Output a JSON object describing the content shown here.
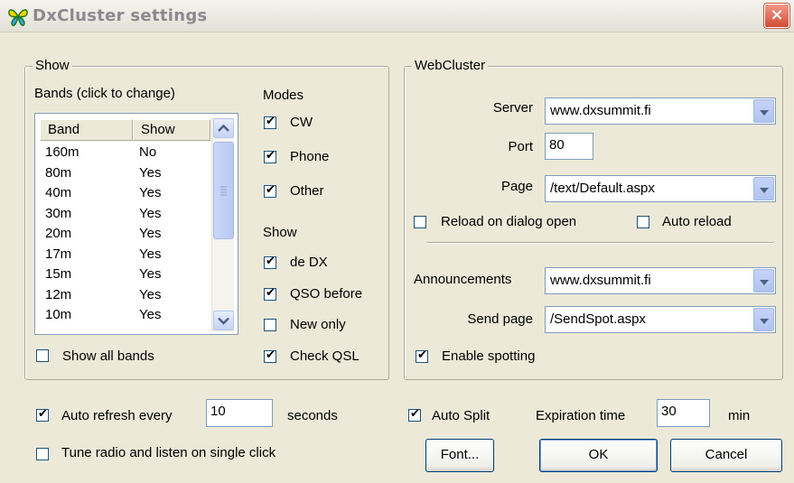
{
  "window": {
    "title": "DxCluster settings",
    "close": "×"
  },
  "show_group": {
    "legend": "Show",
    "bands_label": "Bands (click to change)",
    "columns": [
      "Band",
      "Show"
    ],
    "rows": [
      {
        "band": "160m",
        "show": "No"
      },
      {
        "band": "80m",
        "show": "Yes"
      },
      {
        "band": "40m",
        "show": "Yes"
      },
      {
        "band": "30m",
        "show": "Yes"
      },
      {
        "band": "20m",
        "show": "Yes"
      },
      {
        "band": "17m",
        "show": "Yes"
      },
      {
        "band": "15m",
        "show": "Yes"
      },
      {
        "band": "12m",
        "show": "Yes"
      },
      {
        "band": "10m",
        "show": "Yes"
      }
    ],
    "show_all_bands": "Show all bands",
    "modes_label": "Modes",
    "modes": [
      {
        "label": "CW",
        "checked": true
      },
      {
        "label": "Phone",
        "checked": true
      },
      {
        "label": "Other",
        "checked": true
      }
    ],
    "show_label": "Show",
    "show_opts": [
      {
        "label": "de DX",
        "checked": true
      },
      {
        "label": "QSO before",
        "checked": true
      },
      {
        "label": "New only",
        "checked": false
      },
      {
        "label": "Check QSL",
        "checked": true
      }
    ]
  },
  "webcluster": {
    "legend": "WebCluster",
    "server_label": "Server",
    "server_value": "www.dxsummit.fi",
    "port_label": "Port",
    "port_value": "80",
    "page_label": "Page",
    "page_value": "/text/Default.aspx",
    "reload_on_open": "Reload on dialog open",
    "auto_reload": "Auto reload",
    "announcements_label": "Announcements",
    "announcements_value": "www.dxsummit.fi",
    "send_page_label": "Send page",
    "send_page_value": "/SendSpot.aspx",
    "enable_spotting": "Enable spotting"
  },
  "bottom": {
    "auto_refresh": "Auto refresh every",
    "refresh_value": "10",
    "seconds": "seconds",
    "tune_radio": "Tune radio and listen on single click",
    "auto_split": "Auto Split",
    "expiration_label": "Expiration time",
    "expiration_value": "30",
    "min": "min",
    "font_button": "Font...",
    "ok_button": "OK",
    "cancel_button": "Cancel"
  }
}
